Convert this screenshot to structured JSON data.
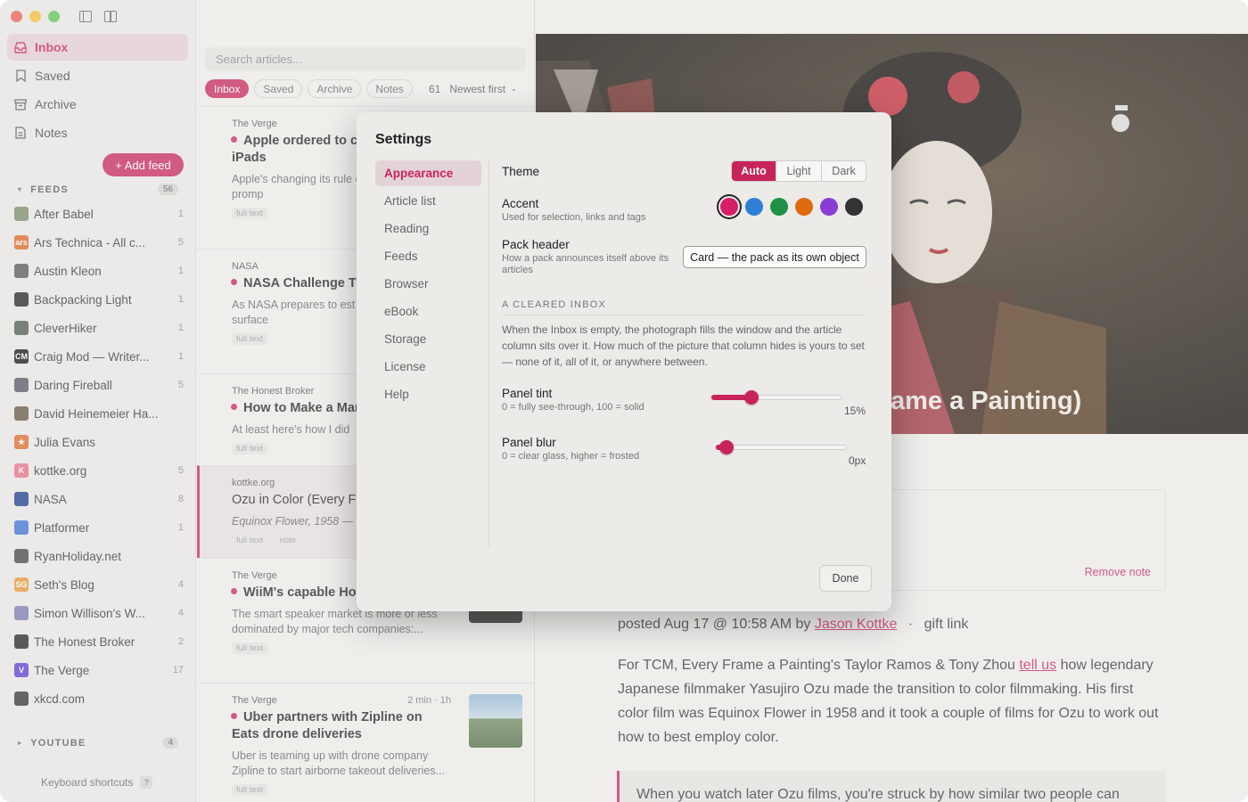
{
  "sidebar": {
    "nav": [
      {
        "label": "Inbox",
        "icon": "inbox-icon",
        "active": true
      },
      {
        "label": "Saved",
        "icon": "bookmark-icon"
      },
      {
        "label": "Archive",
        "icon": "archive-icon"
      },
      {
        "label": "Notes",
        "icon": "notes-icon"
      }
    ],
    "add_feed_label": "+ Add feed",
    "feeds_header": "FEEDS",
    "feeds_count": "56",
    "feeds": [
      {
        "name": "After Babel",
        "count": "1",
        "color": "#7a8a6a"
      },
      {
        "name": "Ars Technica - All c...",
        "count": "5",
        "color": "#e0662a",
        "glyph": "ars"
      },
      {
        "name": "Austin Kleon",
        "count": "1",
        "color": "#555555"
      },
      {
        "name": "Backpacking Light",
        "count": "1",
        "color": "#222222"
      },
      {
        "name": "CleverHiker",
        "count": "1",
        "color": "#4a5a4a"
      },
      {
        "name": "Craig Mod — Writer...",
        "count": "1",
        "color": "#111111",
        "glyph": "CM"
      },
      {
        "name": "Daring Fireball",
        "count": "5",
        "color": "#555566"
      },
      {
        "name": "David Heinemeier Ha...",
        "count": "",
        "color": "#665544"
      },
      {
        "name": "Julia Evans",
        "count": "",
        "color": "#e06a2a",
        "glyph": "★"
      },
      {
        "name": "kottke.org",
        "count": "5",
        "color": "#e8708a",
        "glyph": "K"
      },
      {
        "name": "NASA",
        "count": "8",
        "color": "#1b3c8c"
      },
      {
        "name": "Platformer",
        "count": "1",
        "color": "#3b6fd4"
      },
      {
        "name": "RyanHoliday.net",
        "count": "",
        "color": "#444444"
      },
      {
        "name": "Seth's Blog",
        "count": "4",
        "color": "#e8973a",
        "glyph": "SG"
      },
      {
        "name": "Simon Willison's W...",
        "count": "4",
        "color": "#7a7ab5"
      },
      {
        "name": "The Honest Broker",
        "count": "2",
        "color": "#222222"
      },
      {
        "name": "The Verge",
        "count": "17",
        "color": "#5b3ad4",
        "glyph": "V"
      },
      {
        "name": "xkcd.com",
        "count": "",
        "color": "#333333"
      }
    ],
    "youtube_header": "YOUTUBE",
    "youtube_count": "4",
    "keyboard_shortcuts": "Keyboard shortcuts",
    "kbd_hint": "?"
  },
  "list": {
    "search_placeholder": "Search articles...",
    "chips": [
      "Inbox",
      "Saved",
      "Archive",
      "Notes"
    ],
    "count": "61",
    "sort": "Newest first",
    "cards": [
      {
        "source": "The Verge",
        "title": "Apple ordered to c data consent promp and iPads",
        "excerpt": "Apple's changing its rule collection consent promp",
        "tags": [
          "full text"
        ],
        "unread": true
      },
      {
        "source": "NASA",
        "title": "NASA Challenge T Designs for Moon Ba",
        "excerpt": "As NASA prepares to est Base, advancing surface",
        "tags": [
          "full text"
        ],
        "unread": true
      },
      {
        "source": "The Honest Broker",
        "title": "How to Make a Mar",
        "excerpt": "At least here's how I did",
        "tags": [
          "full text"
        ],
        "unread": true
      },
      {
        "source": "kottke.org",
        "title": "Ozu in Color (Every Fr",
        "excerpt": "Equinox Flower, 1958 — ",
        "tags": [
          "full text",
          "note"
        ],
        "unread": false
      },
      {
        "source": "The Verge",
        "title": "WiiM's capable Ho smart speaker is almost",
        "excerpt": "The smart speaker market is more or less dominated by major tech companies:...",
        "tags": [
          "full text"
        ],
        "unread": true
      },
      {
        "source": "The Verge",
        "title": "Uber partners with Zipline on Eats drone deliveries",
        "excerpt": "Uber is teaming up with drone company Zipline to start airborne takeout deliveries...",
        "tags": [
          "full text"
        ],
        "unread": true,
        "meta": "2 min · 1h"
      }
    ]
  },
  "reader": {
    "hero_title": "ame a Painting)",
    "remove_note": "Remove note",
    "posted_prefix": "posted Aug 17 @ 10:58 AM by",
    "author": "Jason Kottke",
    "sep": "·",
    "gift_link": "gift link",
    "body_1": "For TCM, Every Frame a Painting's Taylor Ramos & Tony Zhou",
    "body_link": "tell us",
    "body_2": "how legendary Japanese filmmaker Yasujiro Ozu made the transition to color filmmaking. His first color film was Equinox Flower in 1958 and it took a couple of films for Ozu to work out how to best employ color.",
    "quote": "When you watch later Ozu films, you're struck by how similar two people can"
  },
  "settings": {
    "title": "Settings",
    "nav": [
      "Appearance",
      "Article list",
      "Reading",
      "Feeds",
      "Browser",
      "eBook",
      "Storage",
      "License",
      "Help"
    ],
    "active_nav": "Appearance",
    "theme_label": "Theme",
    "theme_options": [
      "Auto",
      "Light",
      "Dark"
    ],
    "theme_selected": "Auto",
    "accent_label": "Accent",
    "accent_sub": "Used for selection, links and tags",
    "accent_colors": [
      "#d61f69",
      "#2f7fd6",
      "#1f9046",
      "#e06a10",
      "#8a3cd6",
      "#333333"
    ],
    "accent_selected": "#d61f69",
    "pack_label": "Pack header",
    "pack_sub": "How a pack announces itself above its articles",
    "pack_value": "Card — the pack as its own object",
    "section_header": "A CLEARED INBOX",
    "section_text": "When the Inbox is empty, the photograph fills the window and the article column sits over it. How much of the picture that column hides is yours to set — none of it, all of it, or anywhere between.",
    "tint_label": "Panel tint",
    "tint_sub": "0 = fully see-through, 100 = solid",
    "tint_value": "15%",
    "tint_level": 0.15,
    "blur_label": "Panel blur",
    "blur_sub": "0 = clear glass, higher = frosted",
    "blur_value": "0px",
    "blur_level": 0,
    "done_label": "Done"
  }
}
